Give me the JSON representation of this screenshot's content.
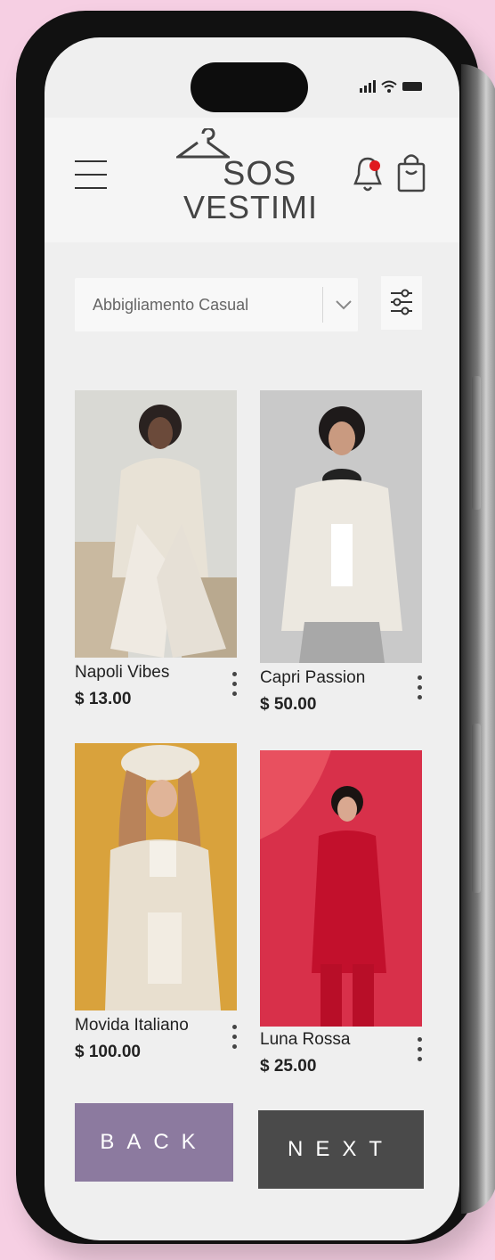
{
  "header": {
    "brand_line1": "SOS",
    "brand_line2": "VESTIMI"
  },
  "filter": {
    "selected_category": "Abbigliamento Casual"
  },
  "products": [
    {
      "name": "Napoli Vibes",
      "price": "$ 13.00"
    },
    {
      "name": "Capri Passion",
      "price": "$ 50.00"
    },
    {
      "name": "Movida Italiano",
      "price": "$ 100.00"
    },
    {
      "name": "Luna Rossa",
      "price": "$ 25.00"
    }
  ],
  "buttons": {
    "back": "BACK",
    "next": "NEXT"
  },
  "colors": {
    "background": "#f6cfe3",
    "back_button": "#8c7a9f",
    "next_button": "#4a4a4a",
    "notification_dot": "#e0191e"
  },
  "icons": [
    "menu-icon",
    "hanger-logo-icon",
    "bell-icon",
    "shopping-bag-icon",
    "chevron-down-icon",
    "sliders-icon",
    "more-vertical-icon"
  ]
}
